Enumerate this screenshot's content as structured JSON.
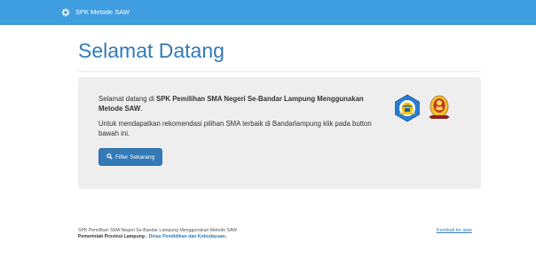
{
  "navbar": {
    "brand_text": "SPK Metode SAW",
    "brand_icon": "cog-icon"
  },
  "header": {
    "title": "Selamat Datang"
  },
  "jumbotron": {
    "intro_prefix": "Selamat datang di ",
    "intro_bold": "SPK Pemilihan SMA Negeri Se-Bandar Lampung Menggunakan Metode SAW",
    "intro_suffix": ".",
    "description": "Untuk mendapatkan rekomendasi pilihan SMA terbaik di Bandarlampung klik pada button bawah ini.",
    "button_label": "Filter Sekarang",
    "button_icon": "search-icon"
  },
  "footer": {
    "line1": "SPK Pemilihan SMA Negeri Se-Bandar Lampung Menggunakan Metode SAW",
    "line2_prefix": "Pemerintah Provinsi Lampung - ",
    "line2_link": "Dinas Pendidikan dan Kebudayaan",
    "line2_suffix": ".",
    "back_to_top": "Kembali ke atas"
  },
  "colors": {
    "navbar": "#3f9ee0",
    "primary": "#337ab7",
    "jumbotron_bg": "#eeeeee"
  }
}
